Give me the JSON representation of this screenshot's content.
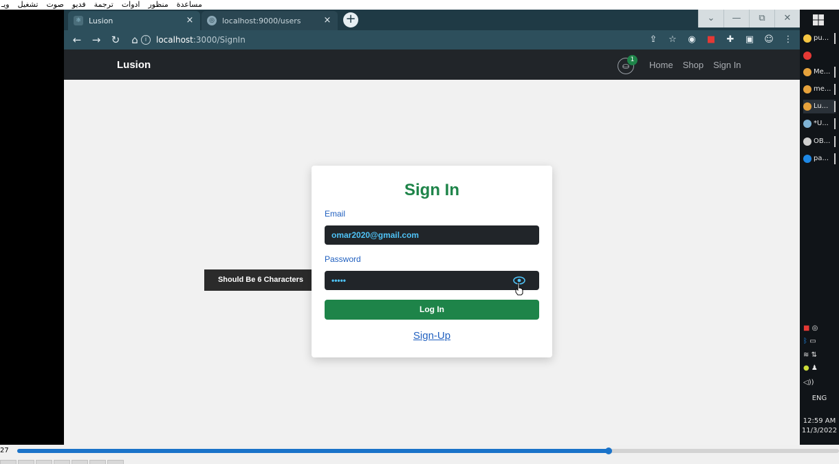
{
  "player": {
    "menu": [
      "مساعدة",
      "منظور",
      "ادوات",
      "ترجمة",
      "فديو",
      "صوت",
      "تشغيل",
      "ويـ"
    ],
    "time": "27",
    "progress_fraction": 0.72
  },
  "browser": {
    "tabs": [
      {
        "label": "Lusion",
        "favicon": "react-icon"
      },
      {
        "label": "localhost:9000/users",
        "favicon": "globe-icon"
      }
    ],
    "new_tab": "+",
    "window_controls": [
      "⌄",
      "—",
      "⧉",
      "✕"
    ],
    "url_host": "localhost",
    "url_path": ":3000/SignIn"
  },
  "site": {
    "brand": "Lusion",
    "cart_count": "1",
    "nav": [
      "Home",
      "Shop",
      "Sign In"
    ]
  },
  "signin": {
    "title": "Sign In",
    "email_label": "Email",
    "email_value": "omar2020@gmail.com",
    "password_label": "Password",
    "password_value": "•••••",
    "login_label": "Log In",
    "signup_label": "Sign-Up",
    "tooltip": "Should Be 6 Characters"
  },
  "taskbar": {
    "items": [
      {
        "label": "pu...",
        "icon": "folder-icon",
        "color": "#f5c542"
      },
      {
        "label": "",
        "icon": "wps-icon",
        "color": "#e53935"
      },
      {
        "label": "Me...",
        "icon": "chrome-icon",
        "color": "#e6a23c"
      },
      {
        "label": "me...",
        "icon": "chrome-icon",
        "color": "#e6a23c"
      },
      {
        "label": "Lu...",
        "icon": "chrome-icon",
        "color": "#e6a23c"
      },
      {
        "label": "*U...",
        "icon": "notepad-icon",
        "color": "#7fb3d5"
      },
      {
        "label": "OB...",
        "icon": "obs-icon",
        "color": "#cfcfcf"
      },
      {
        "label": "pa...",
        "icon": "vscode-icon",
        "color": "#1e88e5"
      }
    ],
    "lang": "ENG",
    "time": "12:59 AM",
    "date": "11/3/2022"
  },
  "colors": {
    "accent_green": "#1e8449",
    "label_blue": "#1f5fbf",
    "nav_dark": "#212529"
  }
}
